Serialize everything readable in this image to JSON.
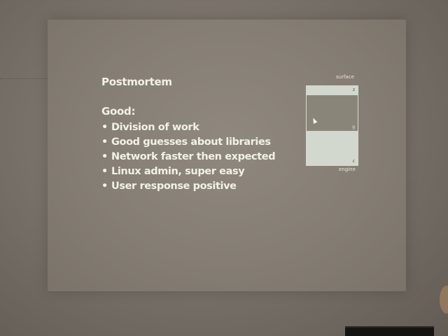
{
  "slide": {
    "title": "Postmortem",
    "subheading": "Good:",
    "bullet_symbol": "•",
    "bullets": [
      "Division of work",
      "Good guesses about libraries",
      "Network faster then expected",
      "Linux admin, super easy",
      "User response positive"
    ]
  },
  "diagram": {
    "top_label": "surface",
    "bottom_label": "engine",
    "marks": [
      "z",
      "g",
      "c"
    ]
  },
  "colors": {
    "wall": "#7a736b",
    "projection": "#857e74",
    "slide_text": "#f2f1e6",
    "diagram_light": "#d3d8ce",
    "diagram_mid": "#8a8579"
  },
  "icons": {
    "cursor": "arrow-cursor-icon"
  }
}
